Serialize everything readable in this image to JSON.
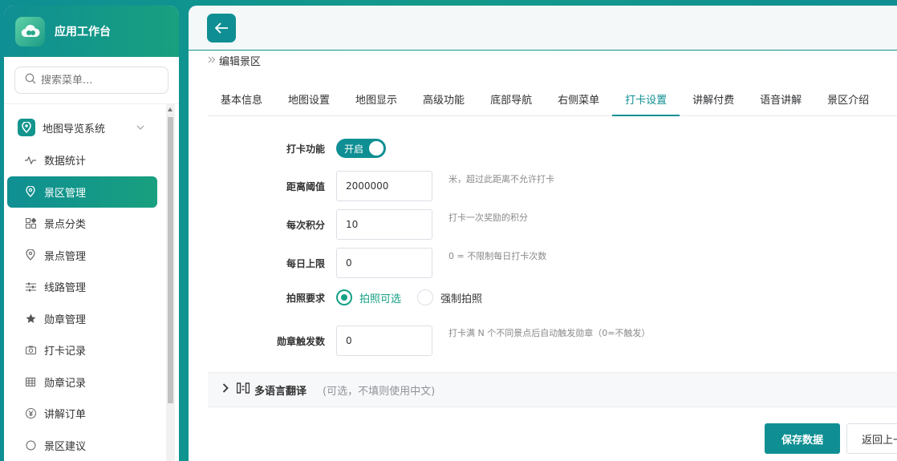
{
  "app": {
    "title": "应用工作台"
  },
  "sidebar": {
    "search_placeholder": "搜索菜单...",
    "group": {
      "label": "地图导览系统"
    },
    "items": [
      {
        "label": "数据统计",
        "icon": "activity-icon"
      },
      {
        "label": "景区管理",
        "icon": "location-pin-icon",
        "active": true
      },
      {
        "label": "景点分类",
        "icon": "grid-icon"
      },
      {
        "label": "景点管理",
        "icon": "location-pin-icon"
      },
      {
        "label": "线路管理",
        "icon": "sliders-icon"
      },
      {
        "label": "勋章管理",
        "icon": "star-icon"
      },
      {
        "label": "打卡记录",
        "icon": "camera-icon"
      },
      {
        "label": "勋章记录",
        "icon": "table-icon"
      },
      {
        "label": "讲解订单",
        "icon": "yen-icon"
      },
      {
        "label": "景区建议",
        "icon": "circle-icon"
      }
    ]
  },
  "breadcrumb": {
    "current": "编辑景区"
  },
  "tabs": [
    "基本信息",
    "地图设置",
    "地图显示",
    "高级功能",
    "底部导航",
    "右侧菜单",
    "打卡设置",
    "讲解付费",
    "语音讲解",
    "景区介绍"
  ],
  "active_tab": "打卡设置",
  "form": {
    "checkin": {
      "label": "打卡功能",
      "switch_text": "开启"
    },
    "distance": {
      "label": "距离阈值",
      "value": "2000000",
      "hint": "米，超过此距离不允许打卡"
    },
    "points": {
      "label": "每次积分",
      "value": "10",
      "hint": "打卡一次奖励的积分"
    },
    "daily_limit": {
      "label": "每日上限",
      "value": "0",
      "hint": "0 = 不限制每日打卡次数"
    },
    "photo": {
      "label": "拍照要求",
      "option1": "拍照可选",
      "option2": "强制拍照"
    },
    "badge": {
      "label": "勋章触发数",
      "value": "0",
      "hint": "打卡满 N 个不同景点后自动触发勋章（0=不触发）"
    }
  },
  "translation": {
    "title": "多语言翻译",
    "subtitle": "(可选，不填则使用中文)"
  },
  "buttons": {
    "save": "保存数据",
    "back": "返回上一页"
  },
  "colors": {
    "primary": "#0f8f93",
    "accent": "#16a085"
  }
}
